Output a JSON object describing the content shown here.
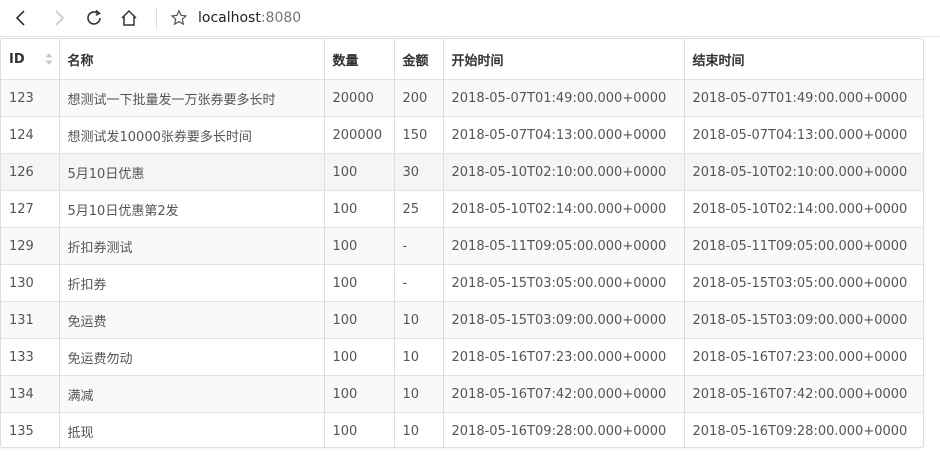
{
  "browser": {
    "url_host": "localhost",
    "url_port": ":8080",
    "icons": [
      "back-icon",
      "forward-icon",
      "reload-icon",
      "home-icon",
      "bookmark-star-icon"
    ]
  },
  "table": {
    "headers": [
      "ID",
      "名称",
      "数量",
      "金额",
      "开始时间",
      "结束时间"
    ],
    "rows": [
      [
        "123",
        "想测试一下批量发一万张券要多长时",
        "20000",
        "200",
        "2018-05-07T01:49:00.000+0000",
        "2018-05-07T01:49:00.000+0000"
      ],
      [
        "124",
        "想测试发10000张券要多长时间",
        "200000",
        "150",
        "2018-05-07T04:13:00.000+0000",
        "2018-05-07T04:13:00.000+0000"
      ],
      [
        "126",
        "5月10日优惠",
        "100",
        "30",
        "2018-05-10T02:10:00.000+0000",
        "2018-05-10T02:10:00.000+0000"
      ],
      [
        "127",
        "5月10日优惠第2发",
        "100",
        "25",
        "2018-05-10T02:14:00.000+0000",
        "2018-05-10T02:14:00.000+0000"
      ],
      [
        "129",
        "折扣券测试",
        "100",
        "-",
        "2018-05-11T09:05:00.000+0000",
        "2018-05-11T09:05:00.000+0000"
      ],
      [
        "130",
        "折扣券",
        "100",
        "-",
        "2018-05-15T03:05:00.000+0000",
        "2018-05-15T03:05:00.000+0000"
      ],
      [
        "131",
        "免运费",
        "100",
        "10",
        "2018-05-15T03:09:00.000+0000",
        "2018-05-15T03:09:00.000+0000"
      ],
      [
        "133",
        "免运费勿动",
        "100",
        "10",
        "2018-05-16T07:23:00.000+0000",
        "2018-05-16T07:23:00.000+0000"
      ],
      [
        "134",
        "满减",
        "100",
        "10",
        "2018-05-16T07:42:00.000+0000",
        "2018-05-16T07:42:00.000+0000"
      ],
      [
        "135",
        "抵现",
        "100",
        "10",
        "2018-05-16T09:28:00.000+0000",
        "2018-05-16T09:28:00.000+0000"
      ]
    ]
  }
}
